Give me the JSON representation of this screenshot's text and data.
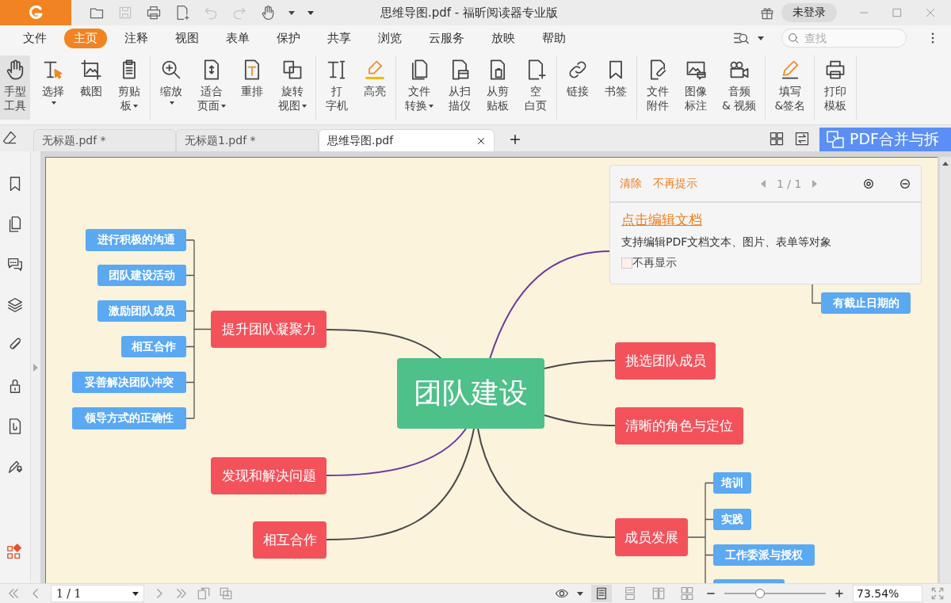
{
  "title_bar": {
    "title": "思维导图.pdf - 福昕阅读器专业版",
    "login": "未登录"
  },
  "menu": [
    {
      "label": "文件",
      "selected": false
    },
    {
      "label": "主页",
      "selected": true
    },
    {
      "label": "注释",
      "selected": false
    },
    {
      "label": "视图",
      "selected": false
    },
    {
      "label": "表单",
      "selected": false
    },
    {
      "label": "保护",
      "selected": false
    },
    {
      "label": "共享",
      "selected": false
    },
    {
      "label": "浏览",
      "selected": false
    },
    {
      "label": "云服务",
      "selected": false
    },
    {
      "label": "放映",
      "selected": false
    },
    {
      "label": "帮助",
      "selected": false
    }
  ],
  "search": {
    "placeholder": "查找"
  },
  "ribbon": [
    {
      "tools": [
        {
          "lines": [
            "手型",
            "工具"
          ],
          "selected": true,
          "dropdown": false
        },
        {
          "lines": [
            "选择"
          ],
          "selected": false,
          "dropdown": true
        },
        {
          "lines": [
            "截图"
          ],
          "selected": false,
          "dropdown": false
        },
        {
          "lines": [
            "剪贴",
            "板"
          ],
          "selected": false,
          "dropdown": true
        }
      ]
    },
    {
      "tools": [
        {
          "lines": [
            "缩放"
          ],
          "selected": false,
          "dropdown": true
        },
        {
          "lines": [
            "适合",
            "页面"
          ],
          "selected": false,
          "dropdown": true
        },
        {
          "lines": [
            "重排"
          ],
          "selected": false,
          "dropdown": false
        },
        {
          "lines": [
            "旋转",
            "视图"
          ],
          "selected": false,
          "dropdown": true
        }
      ]
    },
    {
      "tools": [
        {
          "lines": [
            "打",
            "字机"
          ],
          "selected": false,
          "dropdown": false
        },
        {
          "lines": [
            "高亮"
          ],
          "selected": false,
          "dropdown": false
        }
      ]
    },
    {
      "tools": [
        {
          "lines": [
            "文件",
            "转换"
          ],
          "selected": false,
          "dropdown": true
        },
        {
          "lines": [
            "从扫",
            "描仪"
          ],
          "selected": false,
          "dropdown": false
        },
        {
          "lines": [
            "从剪",
            "贴板"
          ],
          "selected": false,
          "dropdown": false
        },
        {
          "lines": [
            "空",
            "白页"
          ],
          "selected": false,
          "dropdown": false
        }
      ]
    },
    {
      "tools": [
        {
          "lines": [
            "链接"
          ],
          "selected": false,
          "dropdown": false
        },
        {
          "lines": [
            "书签"
          ],
          "selected": false,
          "dropdown": false
        }
      ]
    },
    {
      "tools": [
        {
          "lines": [
            "文件",
            "附件"
          ],
          "selected": false,
          "dropdown": false
        },
        {
          "lines": [
            "图像",
            "标注"
          ],
          "selected": false,
          "dropdown": false
        },
        {
          "lines": [
            "音频",
            "& 视频"
          ],
          "selected": false,
          "dropdown": false
        }
      ]
    },
    {
      "tools": [
        {
          "lines": [
            "填写",
            "&签名"
          ],
          "selected": false,
          "dropdown": false
        }
      ]
    },
    {
      "tools": [
        {
          "lines": [
            "打印",
            "模板"
          ],
          "selected": false,
          "dropdown": false
        }
      ]
    }
  ],
  "tabs": [
    {
      "label": "无标题.pdf *",
      "selected": false
    },
    {
      "label": "无标题1.pdf *",
      "selected": false
    },
    {
      "label": "思维导图.pdf",
      "selected": true
    }
  ],
  "banner": "PDF合并与拆",
  "mind_map": {
    "root": "团队建设",
    "branches": [
      {
        "label": "提升团队凝聚力",
        "color": "#4a4a4a",
        "children": [
          {
            "label": "进行积极的沟通"
          },
          {
            "label": "团队建设活动"
          },
          {
            "label": "激励团队成员"
          },
          {
            "label": "相互合作"
          },
          {
            "label": "妥善解决团队冲突"
          },
          {
            "label": "领导方式的正确性"
          }
        ]
      },
      {
        "color": "#6b3a9e",
        "children": [
          {
            "label": "有截止日期的"
          }
        ]
      },
      {
        "label": "挑选团队成员",
        "color": "#4a4a4a"
      },
      {
        "label": "清晰的角色与定位",
        "color": "#4a4a4a"
      },
      {
        "label": "发现和解决问题",
        "color": "#6b3a9e"
      },
      {
        "label": "相互合作",
        "color": "#4a4a4a"
      },
      {
        "label": "成员发展",
        "color": "#4a4a4a",
        "children": [
          {
            "label": "培训"
          },
          {
            "label": "实践"
          },
          {
            "label": "工作委派与授权"
          }
        ]
      }
    ]
  },
  "popup": {
    "actions": [
      "清除",
      "不再提示"
    ],
    "pager": "1 / 1",
    "link": "点击编辑文档",
    "description": "支持编辑PDF文档文本、图片、表单等对象",
    "checkbox": {
      "label": "不再显示",
      "checked": false
    }
  },
  "status_bar": {
    "page": "1 / 1",
    "layouts": [
      {
        "selected": true
      },
      {
        "selected": false
      },
      {
        "selected": false
      },
      {
        "selected": false
      }
    ],
    "zoom": {
      "level": 0.35,
      "value": "73.54%"
    }
  }
}
